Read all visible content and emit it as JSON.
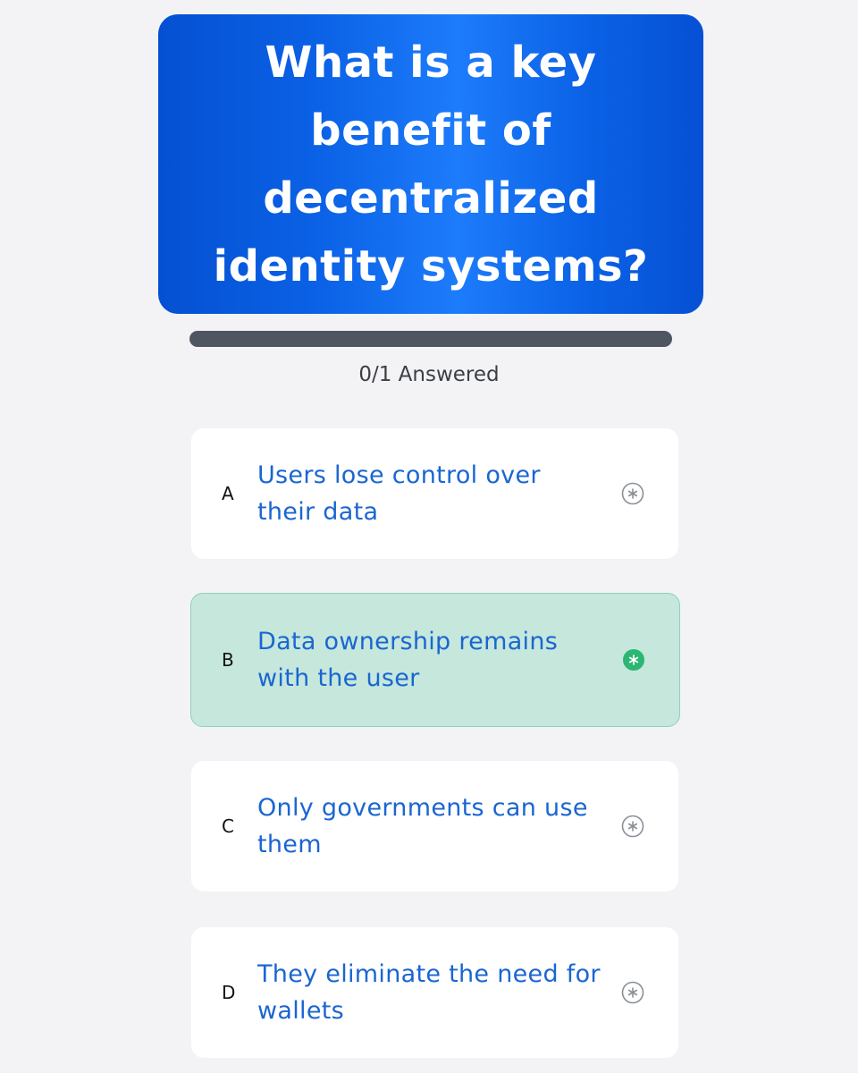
{
  "question": {
    "title": "What is a key benefit of decentralized identity systems?"
  },
  "progress": {
    "answered": 0,
    "total": 1,
    "label": "0/1 Answered"
  },
  "options": [
    {
      "letter": "A",
      "text": "Users lose control over their data",
      "selected": false
    },
    {
      "letter": "B",
      "text": "Data ownership remains with the user",
      "selected": true
    },
    {
      "letter": "C",
      "text": "Only governments can use them",
      "selected": false
    },
    {
      "letter": "D",
      "text": "They eliminate the need for wallets",
      "selected": false
    }
  ],
  "icons": {
    "option_marker": "asterisk-circle-icon"
  },
  "colors": {
    "question_bg": "#0b62e6",
    "progress_track": "#4f5561",
    "option_text": "#1a66d1",
    "selected_bg": "#c5e7dc",
    "selected_icon": "#2bb673",
    "unselected_icon": "#8a8f98"
  }
}
